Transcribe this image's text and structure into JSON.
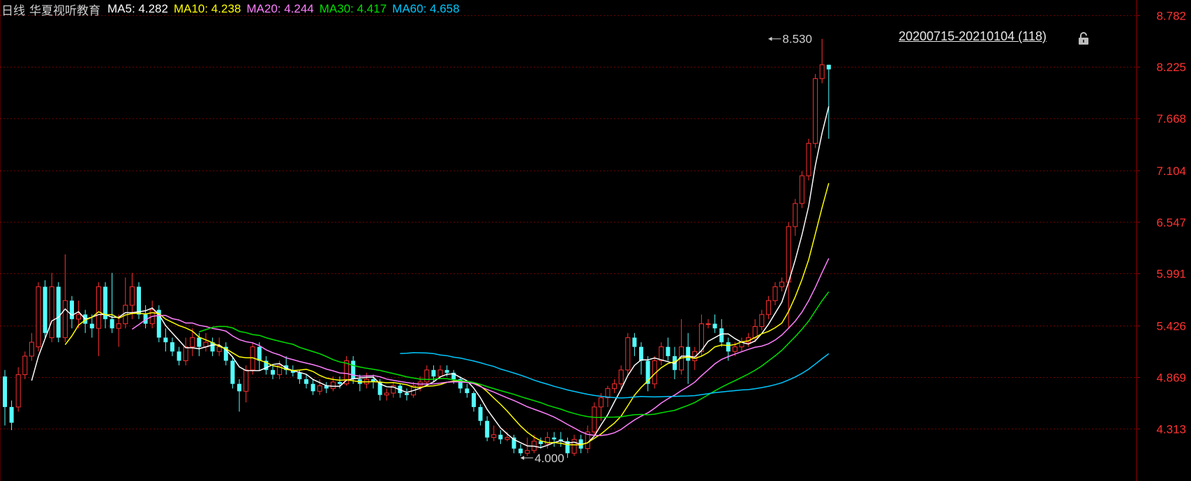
{
  "period_label": "日线",
  "stock_name": "华夏视听教育",
  "range_label": "20200715-20210104 (118)",
  "colors": {
    "up": "#ff3030",
    "down": "#54ffff",
    "grid": "#7a0000",
    "axis": "#a00000",
    "axis_text": "#ff3232",
    "ma5": "#ffffff",
    "ma10": "#ffff00",
    "ma20": "#ff80ff",
    "ma30": "#00e000",
    "ma60": "#00c8ff"
  },
  "ma_legend": [
    {
      "name": "MA5",
      "value": "4.282",
      "color": "#ffffff"
    },
    {
      "name": "MA10",
      "value": "4.238",
      "color": "#ffff00"
    },
    {
      "name": "MA20",
      "value": "4.244",
      "color": "#ff80ff"
    },
    {
      "name": "MA30",
      "value": "4.417",
      "color": "#00e000"
    },
    {
      "name": "MA60",
      "value": "4.658",
      "color": "#00c8ff"
    }
  ],
  "icons": {
    "range_lock": "lock-icon"
  },
  "chart_data": {
    "type": "candlestick",
    "y_ticks": [
      "8.782",
      "8.225",
      "7.668",
      "7.104",
      "6.547",
      "5.991",
      "5.426",
      "4.869",
      "4.313"
    ],
    "ylim": [
      3.75,
      8.95
    ],
    "grid": true,
    "annotations": [
      {
        "text": "8.530",
        "bar": 114,
        "price": 8.53
      },
      {
        "text": "4.000",
        "bar": 77,
        "price": 4.0
      }
    ],
    "bars": [
      [
        4.88,
        4.55,
        4.95,
        4.35
      ],
      [
        4.55,
        4.38,
        4.62,
        4.3
      ],
      [
        4.55,
        4.9,
        4.98,
        4.5
      ],
      [
        4.9,
        5.1,
        5.15,
        4.85
      ],
      [
        5.1,
        5.25,
        5.35,
        5.05
      ],
      [
        5.2,
        5.85,
        5.9,
        5.15
      ],
      [
        5.85,
        5.35,
        5.92,
        5.3
      ],
      [
        5.3,
        5.85,
        6.0,
        5.25
      ],
      [
        5.85,
        5.3,
        5.9,
        5.25
      ],
      [
        5.3,
        5.7,
        6.2,
        5.25
      ],
      [
        5.7,
        5.5,
        5.75,
        5.4
      ],
      [
        5.5,
        5.55,
        5.7,
        5.4
      ],
      [
        5.55,
        5.45,
        5.6,
        5.35
      ],
      [
        5.45,
        5.4,
        5.55,
        5.3
      ],
      [
        5.4,
        5.85,
        5.9,
        5.1
      ],
      [
        5.85,
        5.5,
        5.9,
        5.4
      ],
      [
        5.5,
        5.4,
        6.0,
        5.35
      ],
      [
        5.4,
        5.45,
        5.55,
        5.2
      ],
      [
        5.45,
        5.65,
        5.95,
        5.4
      ],
      [
        5.65,
        5.85,
        6.0,
        5.5
      ],
      [
        5.85,
        5.55,
        5.9,
        5.5
      ],
      [
        5.55,
        5.45,
        5.65,
        5.4
      ],
      [
        5.45,
        5.6,
        5.7,
        5.4
      ],
      [
        5.6,
        5.3,
        5.65,
        5.25
      ],
      [
        5.3,
        5.25,
        5.4,
        5.15
      ],
      [
        5.25,
        5.15,
        5.3,
        5.1
      ],
      [
        5.15,
        5.05,
        5.2,
        5.0
      ],
      [
        5.05,
        5.2,
        5.3,
        5.0
      ],
      [
        5.2,
        5.3,
        5.4,
        5.1
      ],
      [
        5.3,
        5.2,
        5.35,
        5.1
      ],
      [
        5.2,
        5.25,
        5.35,
        5.15
      ],
      [
        5.25,
        5.15,
        5.3,
        5.1
      ],
      [
        5.15,
        5.2,
        5.3,
        5.1
      ],
      [
        5.2,
        5.05,
        5.25,
        5.0
      ],
      [
        5.05,
        4.8,
        5.1,
        4.75
      ],
      [
        4.8,
        4.72,
        4.85,
        4.5
      ],
      [
        4.72,
        4.95,
        5.0,
        4.6
      ],
      [
        4.95,
        5.2,
        5.25,
        4.9
      ],
      [
        5.2,
        5.05,
        5.25,
        4.95
      ],
      [
        5.05,
        4.95,
        5.1,
        4.9
      ],
      [
        4.95,
        4.9,
        5.0,
        4.85
      ],
      [
        4.9,
        5.0,
        5.05,
        4.85
      ],
      [
        5.0,
        4.95,
        5.1,
        4.9
      ],
      [
        4.95,
        4.92,
        5.0,
        4.88
      ],
      [
        4.92,
        4.85,
        4.95,
        4.8
      ],
      [
        4.85,
        4.8,
        4.9,
        4.75
      ],
      [
        4.8,
        4.72,
        4.85,
        4.68
      ],
      [
        4.72,
        4.78,
        4.85,
        4.68
      ],
      [
        4.78,
        4.75,
        4.82,
        4.7
      ],
      [
        4.75,
        4.82,
        4.88,
        4.72
      ],
      [
        4.82,
        4.8,
        4.88,
        4.75
      ],
      [
        4.8,
        5.05,
        5.1,
        4.78
      ],
      [
        5.05,
        4.85,
        5.1,
        4.8
      ],
      [
        4.85,
        4.8,
        4.9,
        4.72
      ],
      [
        4.8,
        4.85,
        4.92,
        4.75
      ],
      [
        4.85,
        4.82,
        4.9,
        4.75
      ],
      [
        4.82,
        4.68,
        4.85,
        4.62
      ],
      [
        4.68,
        4.7,
        4.75,
        4.62
      ],
      [
        4.7,
        4.78,
        4.82,
        4.65
      ],
      [
        4.78,
        4.7,
        4.8,
        4.65
      ],
      [
        4.7,
        4.68,
        4.75,
        4.62
      ],
      [
        4.68,
        4.78,
        4.82,
        4.65
      ],
      [
        4.78,
        4.82,
        4.88,
        4.72
      ],
      [
        4.82,
        4.95,
        5.0,
        4.8
      ],
      [
        4.95,
        4.88,
        5.0,
        4.82
      ],
      [
        4.88,
        4.95,
        5.0,
        4.85
      ],
      [
        4.95,
        4.92,
        5.0,
        4.88
      ],
      [
        4.92,
        4.85,
        4.95,
        4.8
      ],
      [
        4.85,
        4.75,
        4.88,
        4.7
      ],
      [
        4.75,
        4.7,
        4.8,
        4.65
      ],
      [
        4.7,
        4.55,
        4.72,
        4.5
      ],
      [
        4.55,
        4.4,
        4.58,
        4.35
      ],
      [
        4.4,
        4.22,
        4.45,
        4.18
      ],
      [
        4.22,
        4.25,
        4.35,
        4.18
      ],
      [
        4.25,
        4.2,
        4.3,
        4.15
      ],
      [
        4.2,
        4.22,
        4.28,
        4.18
      ],
      [
        4.22,
        4.1,
        4.25,
        4.05
      ],
      [
        4.1,
        4.05,
        4.15,
        4.02
      ],
      [
        4.05,
        4.08,
        4.22,
        4.02
      ],
      [
        4.08,
        4.18,
        4.25,
        4.05
      ],
      [
        4.18,
        4.15,
        4.22,
        4.1
      ],
      [
        4.15,
        4.22,
        4.28,
        4.1
      ],
      [
        4.22,
        4.2,
        4.28,
        4.12
      ],
      [
        4.2,
        4.18,
        4.28,
        4.12
      ],
      [
        4.18,
        4.05,
        4.22,
        4.0
      ],
      [
        4.05,
        4.2,
        4.25,
        4.02
      ],
      [
        4.2,
        4.1,
        4.25,
        4.05
      ],
      [
        4.1,
        4.28,
        4.35,
        4.05
      ],
      [
        4.28,
        4.55,
        4.6,
        4.25
      ],
      [
        4.55,
        4.65,
        4.7,
        4.4
      ],
      [
        4.65,
        4.75,
        4.78,
        4.55
      ],
      [
        4.75,
        4.8,
        4.85,
        4.7
      ],
      [
        4.8,
        4.95,
        5.0,
        4.75
      ],
      [
        4.95,
        5.3,
        5.35,
        4.9
      ],
      [
        5.3,
        5.2,
        5.35,
        5.1
      ],
      [
        5.2,
        5.05,
        5.25,
        4.9
      ],
      [
        5.05,
        4.8,
        5.1,
        4.72
      ],
      [
        4.8,
        5.05,
        5.1,
        4.75
      ],
      [
        5.05,
        5.2,
        5.25,
        5.0
      ],
      [
        5.2,
        5.1,
        5.3,
        5.05
      ],
      [
        5.1,
        4.95,
        5.2,
        4.85
      ],
      [
        4.95,
        5.2,
        5.5,
        4.9
      ],
      [
        5.2,
        5.05,
        5.35,
        4.8
      ],
      [
        5.05,
        5.15,
        5.2,
        4.95
      ],
      [
        5.15,
        5.45,
        5.55,
        5.1
      ],
      [
        5.45,
        5.45,
        5.5,
        5.4
      ],
      [
        5.45,
        5.4,
        5.55,
        5.35
      ],
      [
        5.4,
        5.25,
        5.5,
        5.2
      ],
      [
        5.25,
        5.15,
        5.3,
        5.05
      ],
      [
        5.15,
        5.2,
        5.25,
        5.1
      ],
      [
        5.2,
        5.25,
        5.3,
        5.15
      ],
      [
        5.25,
        5.3,
        5.35,
        5.2
      ],
      [
        5.3,
        5.42,
        5.5,
        5.25
      ],
      [
        5.42,
        5.55,
        5.6,
        5.38
      ],
      [
        5.55,
        5.7,
        5.75,
        5.5
      ],
      [
        5.7,
        5.85,
        5.9,
        5.65
      ],
      [
        5.85,
        5.9,
        5.95,
        5.8
      ],
      [
        5.9,
        6.5,
        6.55,
        5.4
      ],
      [
        6.5,
        6.75,
        6.8,
        6.4
      ],
      [
        6.75,
        7.05,
        7.1,
        6.7
      ],
      [
        7.05,
        7.4,
        7.45,
        7.0
      ],
      [
        7.4,
        8.1,
        8.15,
        7.35
      ],
      [
        8.1,
        8.25,
        8.53,
        8.05
      ],
      [
        8.25,
        8.2,
        8.25,
        7.45
      ]
    ]
  }
}
